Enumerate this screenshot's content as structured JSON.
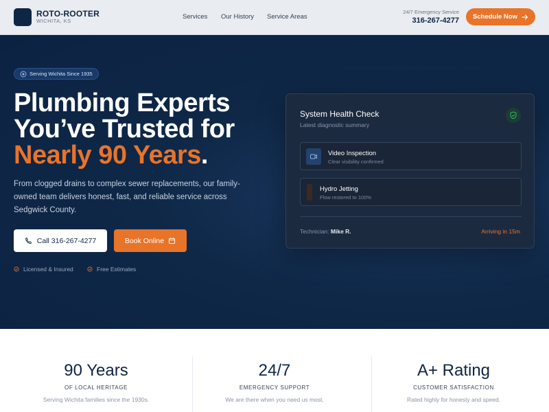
{
  "header": {
    "brand_name": "ROTO-ROOTER",
    "brand_location": "WICHITA, KS",
    "nav": [
      "Services",
      "Our History",
      "Service Areas"
    ],
    "emergency_label": "24/7 Emergency Service",
    "emergency_phone": "316-267-4277",
    "schedule_label": "Schedule Now"
  },
  "hero": {
    "badge": "Serving Wichita Since 1935",
    "headline_line1": "Plumbing Experts",
    "headline_line2": "You’ve Trusted for",
    "headline_accent": "Nearly 90 Years",
    "headline_period": ".",
    "subtext": "From clogged drains to complex sewer replacements, our family-owned team delivers honest, fast, and reliable service across Sedgwick County.",
    "call_label": "Call 316-267-4277",
    "book_label": "Book Online",
    "trust": [
      "Licensed & Insured",
      "Free Estimates"
    ]
  },
  "health_card": {
    "title": "System Health Check",
    "subtitle": "Latest diagnostic summary",
    "items": [
      {
        "title": "Video Inspection",
        "desc": "Clear visibility confirmed"
      },
      {
        "title": "Hydro Jetting",
        "desc": "Flow restored to 100%"
      }
    ],
    "technician_label": "Technician:",
    "technician_name": "Mike R.",
    "arrival": "Arriving in 15m"
  },
  "stats": [
    {
      "value": "90 Years",
      "label": "OF LOCAL HERITAGE",
      "desc": "Serving Wichita families since the 1930s."
    },
    {
      "value": "24/7",
      "label": "EMERGENCY SUPPORT",
      "desc": "We are there when you need us most."
    },
    {
      "value": "A+ Rating",
      "label": "CUSTOMER SATISFACTION",
      "desc": "Rated highly for honesty and speed."
    }
  ],
  "colors": {
    "navy": "#0f2544",
    "accent": "#e8742a",
    "success": "#22c55e"
  }
}
